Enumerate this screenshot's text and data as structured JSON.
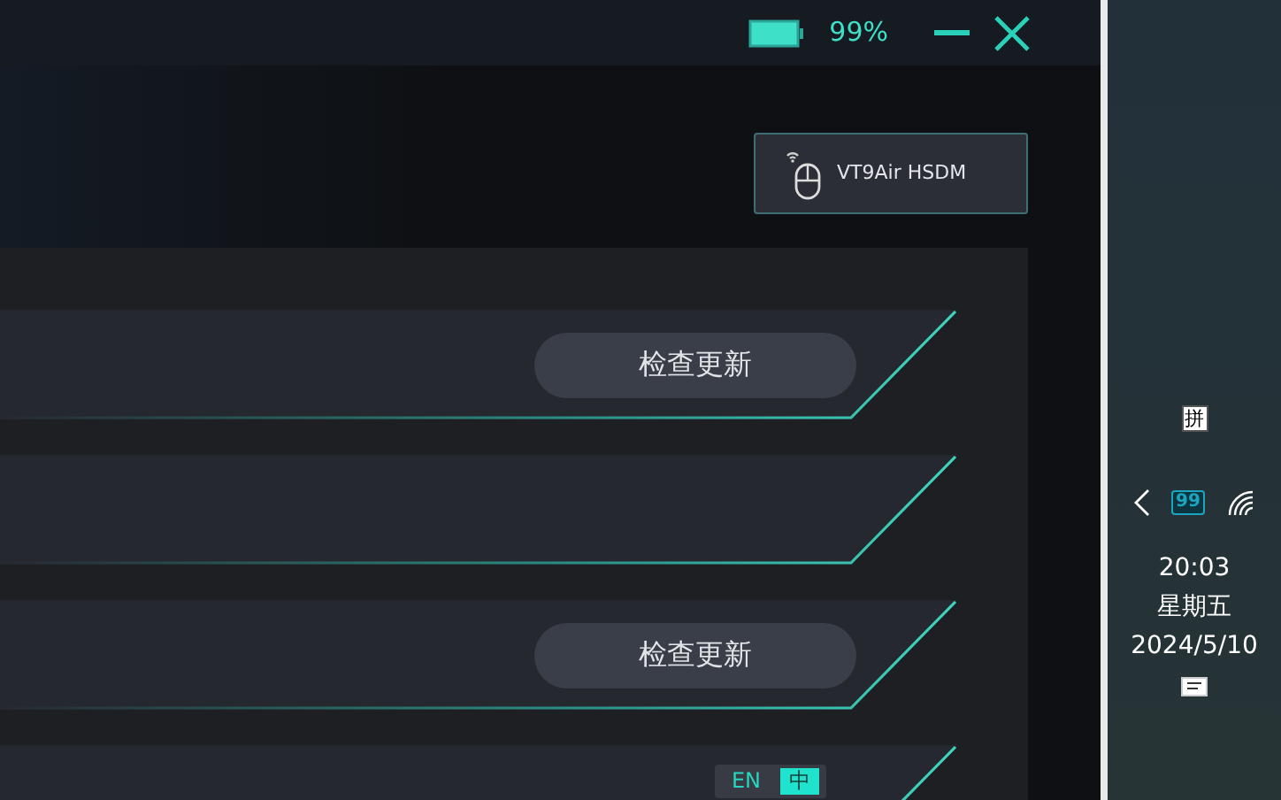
{
  "window": {
    "battery_text": "99%"
  },
  "device": {
    "name": "VT9Air HSDM"
  },
  "rows": [
    {
      "kind": "update",
      "button": "检查更新"
    },
    {
      "kind": "plain"
    },
    {
      "kind": "update",
      "button": "检查更新"
    },
    {
      "kind": "language",
      "options": [
        {
          "label": "EN",
          "selected": false
        },
        {
          "label": "中",
          "selected": true
        }
      ]
    }
  ],
  "taskbar": {
    "ime": "拼",
    "battery": "99",
    "time": "20:03",
    "weekday": "星期五",
    "date": "2024/5/10"
  }
}
